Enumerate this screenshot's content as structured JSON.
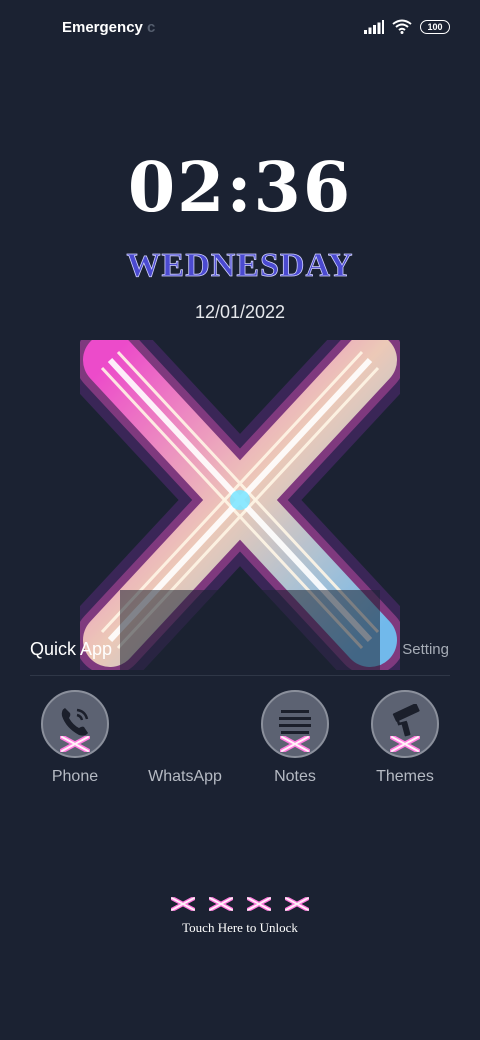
{
  "status_bar": {
    "carrier": "Emergency",
    "carrier_trail": "c",
    "battery": "100",
    "icons": [
      "signal-icon",
      "wifi-icon",
      "battery-icon"
    ]
  },
  "lockscreen": {
    "time": "02:36",
    "weekday": "WEDNESDAY",
    "date": "12/01/2022",
    "wallpaper": "neon-x-wallpaper",
    "accent": "#4b4ad0",
    "background": "#1b2232"
  },
  "quick_app": {
    "title": "Quick App",
    "setting": "Setting",
    "apps": [
      {
        "label": "Phone",
        "icon": "phone-icon"
      },
      {
        "label": "WhatsApp",
        "icon": ""
      },
      {
        "label": "Notes",
        "icon": "notes-icon"
      },
      {
        "label": "Themes",
        "icon": "paint-roller-icon"
      }
    ]
  },
  "unlock": {
    "glyphs": "X X X X",
    "label": "Touch Here to Unlock"
  }
}
